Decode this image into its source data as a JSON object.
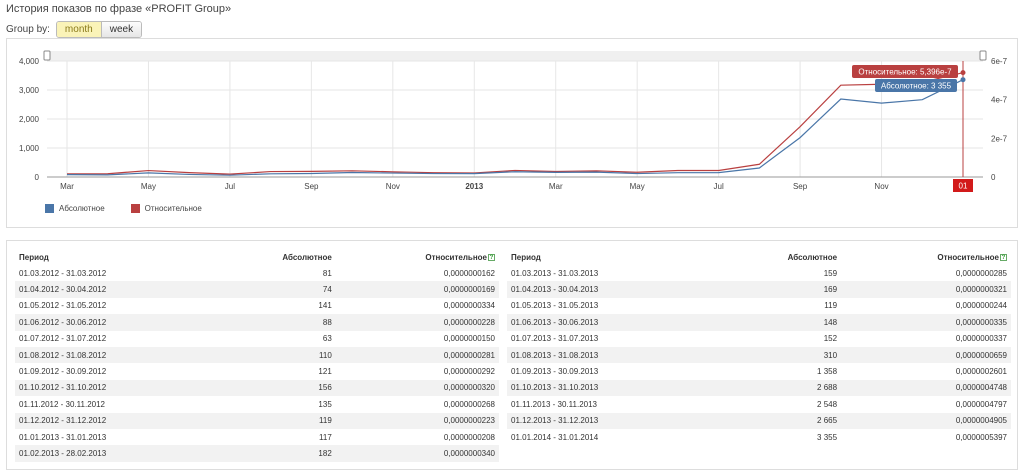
{
  "header": {
    "title": "История показов по фразе «PROFIT Group»",
    "group_by_label": "Group by:",
    "month_label": "month",
    "week_label": "week"
  },
  "colors": {
    "absolute": "#4a76a8",
    "relative": "#b94040",
    "grid": "#e6e6e6",
    "active_toggle": "#faf3b8"
  },
  "chart_data": {
    "type": "line",
    "x": [
      "2012-03",
      "2012-04",
      "2012-05",
      "2012-06",
      "2012-07",
      "2012-08",
      "2012-09",
      "2012-10",
      "2012-11",
      "2012-12",
      "2013-01",
      "2013-02",
      "2013-03",
      "2013-04",
      "2013-05",
      "2013-06",
      "2013-07",
      "2013-08",
      "2013-09",
      "2013-10",
      "2013-11",
      "2013-12",
      "2014-01"
    ],
    "x_tick_labels": [
      "Mar",
      "May",
      "Jul",
      "Sep",
      "Nov",
      "2013",
      "Mar",
      "May",
      "Jul",
      "Sep",
      "Nov",
      "01"
    ],
    "series": [
      {
        "name": "Абсолютное",
        "axis": "left",
        "values": [
          81,
          74,
          141,
          88,
          63,
          110,
          121,
          156,
          135,
          119,
          117,
          182,
          159,
          169,
          119,
          148,
          152,
          310,
          1358,
          2688,
          2548,
          2665,
          3355
        ]
      },
      {
        "name": "Относительное",
        "axis": "right",
        "values": [
          1.62e-08,
          1.69e-08,
          3.34e-08,
          2.28e-08,
          1.5e-08,
          2.81e-08,
          2.92e-08,
          3.2e-08,
          2.68e-08,
          2.23e-08,
          2.08e-08,
          3.4e-08,
          2.85e-08,
          3.21e-08,
          2.44e-08,
          3.35e-08,
          3.37e-08,
          6.59e-08,
          2.601e-07,
          4.748e-07,
          4.797e-07,
          4.905e-07,
          5.397e-07
        ]
      }
    ],
    "y_left_ticks": [
      "4,000",
      "3,000",
      "2,000",
      "1,000",
      "0"
    ],
    "y_left_range": [
      0,
      4000
    ],
    "y_right_ticks": [
      "6e-7",
      "4e-7",
      "2e-7",
      "0"
    ],
    "y_right_range": [
      0,
      6e-07
    ],
    "grid": true,
    "legend_position": "bottom-left",
    "tooltips": [
      {
        "label": "Относительное: 5,396e-7",
        "series": "Относительное"
      },
      {
        "label": "Абсолютное: 3 355",
        "series": "Абсолютное"
      }
    ],
    "crosshair_label": "01"
  },
  "legend": {
    "absolute": "Абсолютное",
    "relative": "Относительное"
  },
  "table": {
    "headers": {
      "period": "Период",
      "absolute": "Абсолютное",
      "relative": "Относительное"
    },
    "left_rows": [
      {
        "period": "01.03.2012 - 31.03.2012",
        "abs": "81",
        "rel": "0,0000000162"
      },
      {
        "period": "01.04.2012 - 30.04.2012",
        "abs": "74",
        "rel": "0,0000000169"
      },
      {
        "period": "01.05.2012 - 31.05.2012",
        "abs": "141",
        "rel": "0,0000000334"
      },
      {
        "period": "01.06.2012 - 30.06.2012",
        "abs": "88",
        "rel": "0,0000000228"
      },
      {
        "period": "01.07.2012 - 31.07.2012",
        "abs": "63",
        "rel": "0,0000000150"
      },
      {
        "period": "01.08.2012 - 31.08.2012",
        "abs": "110",
        "rel": "0,0000000281"
      },
      {
        "period": "01.09.2012 - 30.09.2012",
        "abs": "121",
        "rel": "0,0000000292"
      },
      {
        "period": "01.10.2012 - 31.10.2012",
        "abs": "156",
        "rel": "0,0000000320"
      },
      {
        "period": "01.11.2012 - 30.11.2012",
        "abs": "135",
        "rel": "0,0000000268"
      },
      {
        "period": "01.12.2012 - 31.12.2012",
        "abs": "119",
        "rel": "0,0000000223"
      },
      {
        "period": "01.01.2013 - 31.01.2013",
        "abs": "117",
        "rel": "0,0000000208"
      },
      {
        "period": "01.02.2013 - 28.02.2013",
        "abs": "182",
        "rel": "0,0000000340"
      }
    ],
    "right_rows": [
      {
        "period": "01.03.2013 - 31.03.2013",
        "abs": "159",
        "rel": "0,0000000285"
      },
      {
        "period": "01.04.2013 - 30.04.2013",
        "abs": "169",
        "rel": "0,0000000321"
      },
      {
        "period": "01.05.2013 - 31.05.2013",
        "abs": "119",
        "rel": "0,0000000244"
      },
      {
        "period": "01.06.2013 - 30.06.2013",
        "abs": "148",
        "rel": "0,0000000335"
      },
      {
        "period": "01.07.2013 - 31.07.2013",
        "abs": "152",
        "rel": "0,0000000337"
      },
      {
        "period": "01.08.2013 - 31.08.2013",
        "abs": "310",
        "rel": "0,0000000659"
      },
      {
        "period": "01.09.2013 - 30.09.2013",
        "abs": "1 358",
        "rel": "0,0000002601"
      },
      {
        "period": "01.10.2013 - 31.10.2013",
        "abs": "2 688",
        "rel": "0,0000004748"
      },
      {
        "period": "01.11.2013 - 30.11.2013",
        "abs": "2 548",
        "rel": "0,0000004797"
      },
      {
        "period": "01.12.2013 - 31.12.2013",
        "abs": "2 665",
        "rel": "0,0000004905"
      },
      {
        "period": "01.01.2014 - 31.01.2014",
        "abs": "3 355",
        "rel": "0,0000005397"
      }
    ]
  }
}
